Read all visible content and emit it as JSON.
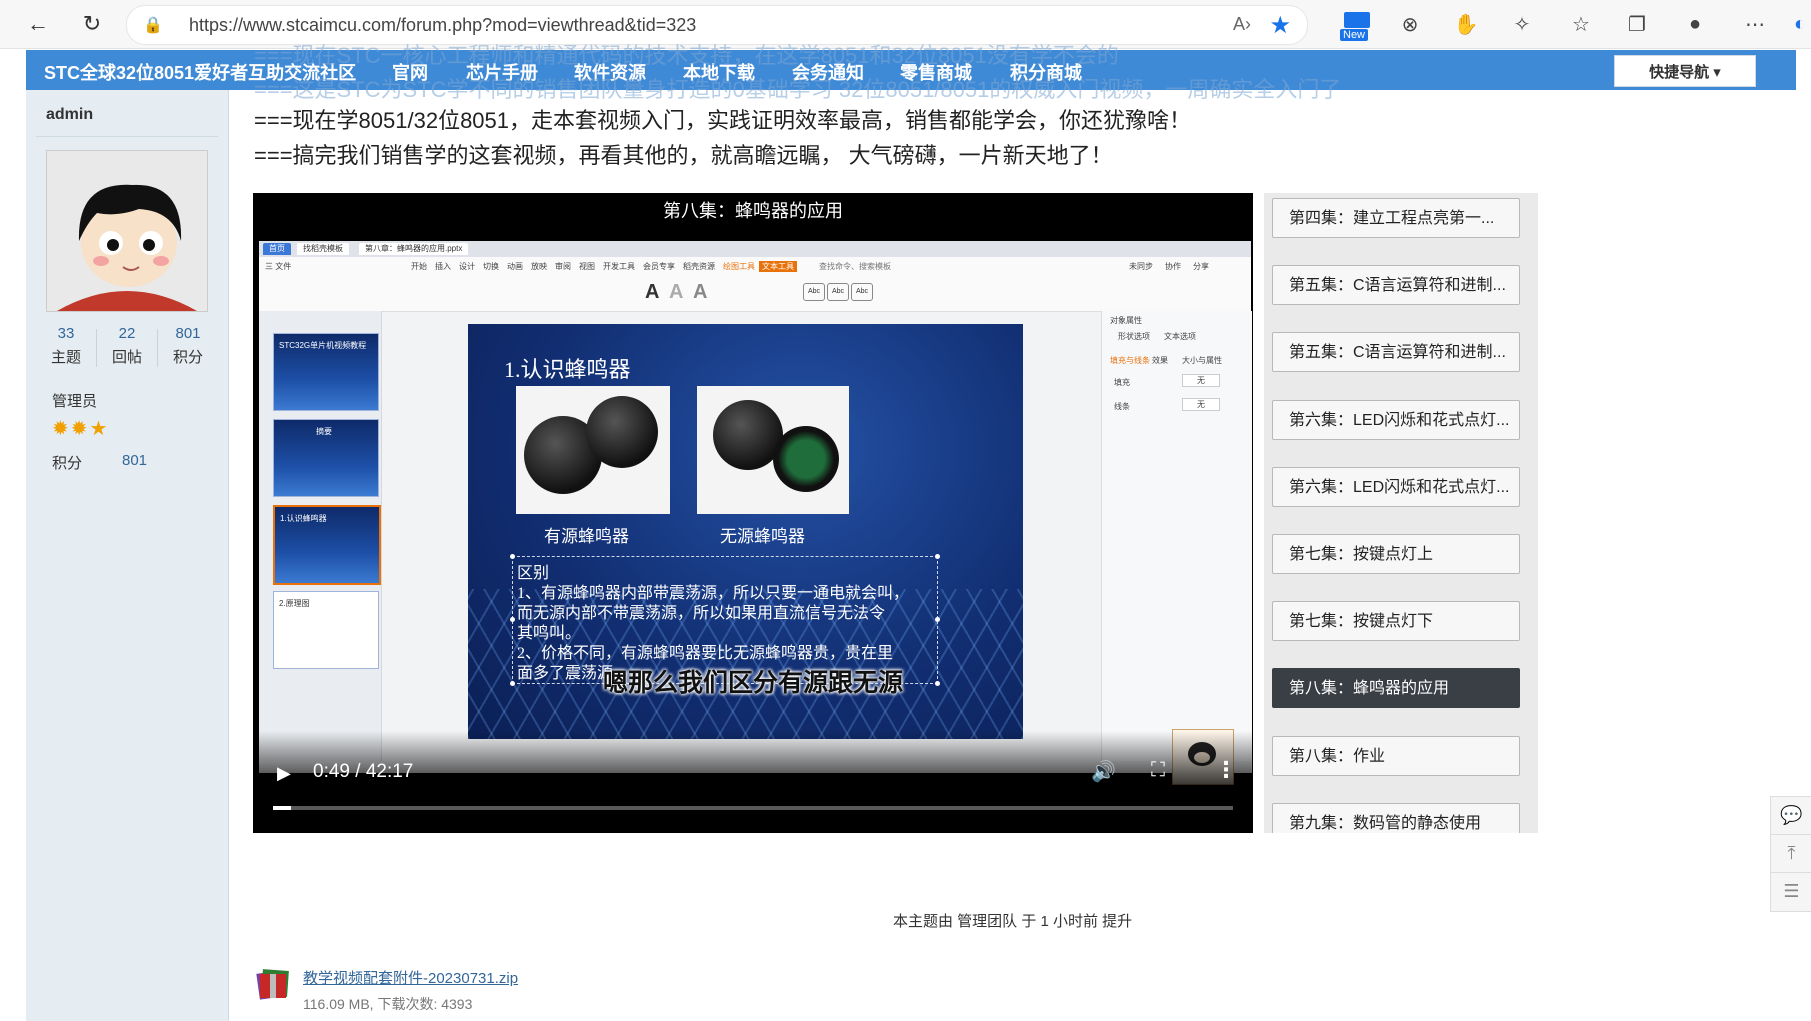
{
  "browser": {
    "url": "https://www.stcaimcu.com/forum.php?mod=viewthread&tid=323",
    "ext_new_label": "New"
  },
  "site": {
    "brand": "STC全球32位8051爱好者互助交流社区",
    "nav": [
      "官网",
      "芯片手册",
      "软件资源",
      "本地下载",
      "会务通知",
      "零售商城",
      "积分商城"
    ],
    "quick_nav": "快捷导航 ▾"
  },
  "sidebar": {
    "username": "admin",
    "stats": [
      {
        "num": "33",
        "label": "主题"
      },
      {
        "num": "22",
        "label": "回帖"
      },
      {
        "num": "801",
        "label": "积分"
      }
    ],
    "role": "管理员",
    "stars": "✹✹★",
    "credit_label": "积分",
    "credit_value": "801"
  },
  "post": {
    "ghost_line1": "===现在STC一核心工程师和精通代码的技术支持，在这学8051和32位8051没有学不会的",
    "ghost_line2": "===这是STC为STC学不同的销售团队量身打造的0基础学习 32位8051/8051的权威入门视频，一周确实全入门了",
    "line3": "===现在学8051/32位8051，走本套视频入门，实践证明效率最高，销售都能学会，你还犹豫啥！",
    "line4": "===搞完我们销售学的这套视频，再看其他的，就高瞻远瞩， 大气磅礴，一片新天地了！"
  },
  "video": {
    "title": "第八集：蜂鸣器的应用",
    "subtitle": "嗯那么我们区分有源跟无源",
    "time": "0:49 / 42:17",
    "progress": 0.019,
    "app": {
      "tab_home": "首页",
      "tab_tpl": "找稻壳模板",
      "tab_file": "第八章：蜂鸣器的应用.pptx",
      "ribbon_items": [
        "三 文件",
        "开始",
        "插入",
        "设计",
        "切换",
        "动画",
        "放映",
        "审阅",
        "视图",
        "开发工具",
        "会员专享",
        "稻壳资源",
        "绘图工具",
        "文本工具",
        "查找命令、搜索模板",
        "未同步",
        "协作",
        "分享"
      ],
      "thumb_titles": [
        "STC32G单片机视频教程",
        "摘要",
        "1.认识蜂鸣器",
        "2.原理图"
      ],
      "props_title": "对象属性",
      "props_tabs": [
        "形状选项",
        "文本选项"
      ],
      "props_items": [
        "填充与线条",
        "效果",
        "大小与属性",
        "填充",
        "无",
        "线条",
        "无"
      ]
    },
    "slide": {
      "title": "1.认识蜂鸣器",
      "cap_active": "有源蜂鸣器",
      "cap_passive": "无源蜂鸣器",
      "box_lines": [
        "区别",
        "1、有源蜂鸣器内部带震荡源，所以只要一通电就会叫，",
        "而无源内部不带震荡源，所以如果用直流信号无法令",
        "其鸣叫。",
        "2、价格不同，有源蜂鸣器要比无源蜂鸣器贵，贵在里",
        "面多了震荡源。"
      ]
    }
  },
  "playlist": [
    {
      "label": "第四集：建立工程点亮第一...",
      "active": false
    },
    {
      "label": "第五集：C语言运算符和进制...",
      "active": false
    },
    {
      "label": "第五集：C语言运算符和进制...",
      "active": false
    },
    {
      "label": "第六集：LED闪烁和花式点灯...",
      "active": false
    },
    {
      "label": "第六集：LED闪烁和花式点灯...",
      "active": false
    },
    {
      "label": "第七集：按键点灯上",
      "active": false
    },
    {
      "label": "第七集：按键点灯下",
      "active": false
    },
    {
      "label": "第八集：蜂鸣器的应用",
      "active": true
    },
    {
      "label": "第八集：作业",
      "active": false
    },
    {
      "label": "第九集：数码管的静态使用",
      "active": false
    }
  ],
  "footer": {
    "note": "本主题由 管理团队 于 1 小时前 提升",
    "attachment_name": "教学视频配套附件-20230731.zip",
    "attachment_meta": "116.09 MB, 下载次数: 4393"
  },
  "colors": {
    "nav_bg": "#3f8ad6",
    "link": "#336699",
    "active_item": "#3a3e45"
  }
}
